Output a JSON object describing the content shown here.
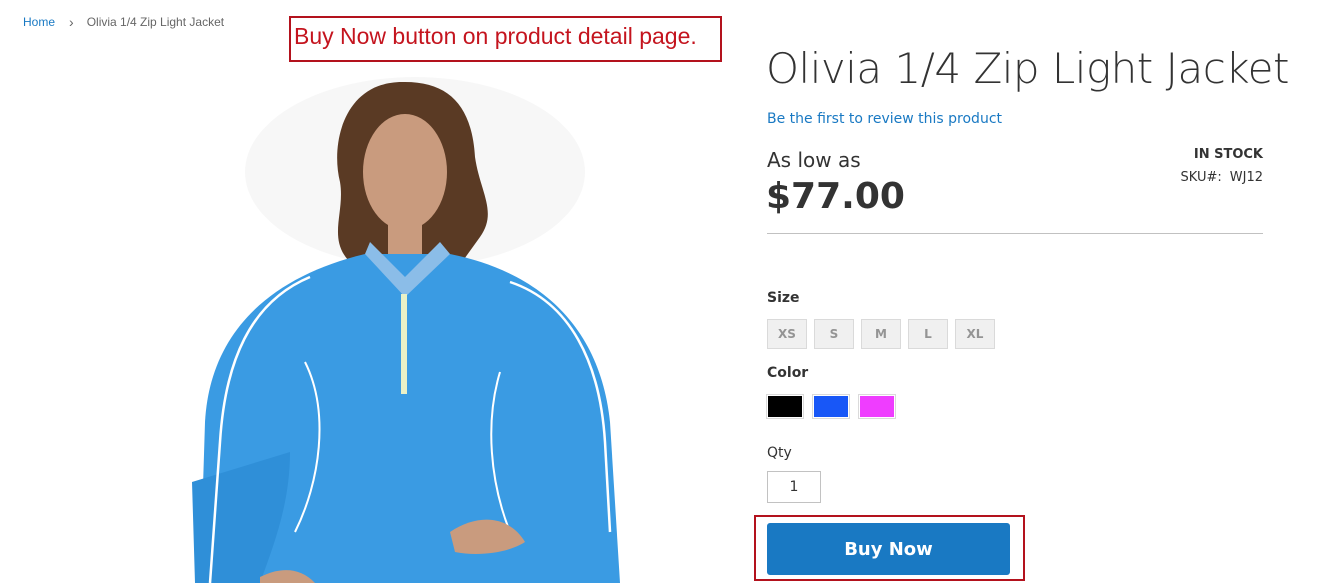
{
  "breadcrumb": {
    "home": "Home",
    "separator": "›",
    "current": "Olivia 1/4 Zip Light Jacket"
  },
  "annotation": {
    "text": "Buy Now button on product detail page."
  },
  "product": {
    "title": "Olivia 1/4 Zip Light Jacket",
    "review_link": "Be the first to review this product",
    "price_prefix": "As low as",
    "price": "$77.00",
    "stock": "IN STOCK",
    "sku_label": "SKU#:",
    "sku_value": "WJ12"
  },
  "options": {
    "size_label": "Size",
    "sizes": [
      "XS",
      "S",
      "M",
      "L",
      "XL"
    ],
    "color_label": "Color",
    "colors": [
      {
        "name": "Black",
        "hex": "#000000"
      },
      {
        "name": "Blue",
        "hex": "#1857f7"
      },
      {
        "name": "Purple",
        "hex": "#ef3dff"
      }
    ],
    "qty_label": "Qty",
    "qty_value": "1"
  },
  "actions": {
    "buy_now": "Buy Now"
  },
  "colors": {
    "link": "#1979c3",
    "primary_button": "#1979c3",
    "annotation": "#c4141e"
  }
}
